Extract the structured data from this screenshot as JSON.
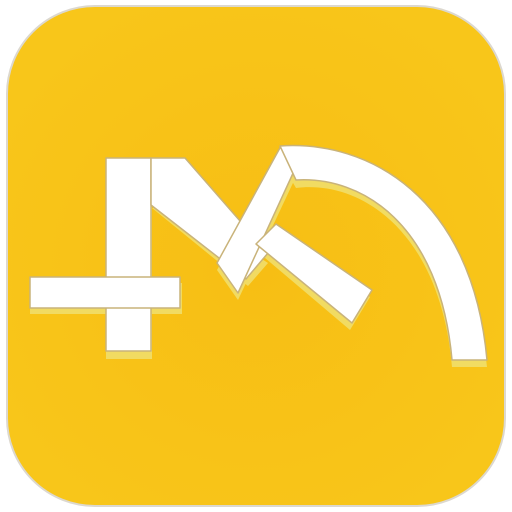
{
  "icon": {
    "name": "app-logo-icon",
    "colors": {
      "background_center": "#f7be14",
      "background_edge": "#f8c61a",
      "tile_border": "#dcd8cf",
      "mark_fill": "#ffffff",
      "mark_outline": "#c9b37a",
      "mark_shadow": "#f0e070"
    }
  }
}
